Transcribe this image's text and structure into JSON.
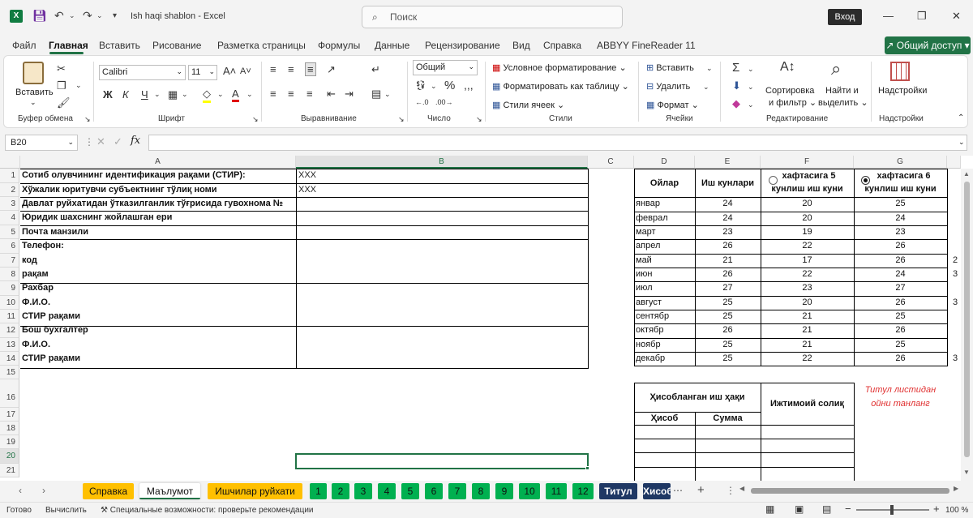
{
  "title": {
    "doc": "Ish haqi shablon",
    "sep": "-",
    "app": "Excel",
    "search": "Поиск",
    "login": "Вход"
  },
  "menu": [
    "Файл",
    "Главная",
    "Вставить",
    "Рисование",
    "Разметка страницы",
    "Формулы",
    "Данные",
    "Рецензирование",
    "Вид",
    "Справка",
    "ABBYY FineReader 11"
  ],
  "share": "Общий доступ",
  "ribbon": {
    "clipboard": {
      "paste": "Вставить",
      "label": "Буфер обмена"
    },
    "font": {
      "name": "Calibri",
      "size": "11",
      "bold": "Ж",
      "italic": "К",
      "underline": "Ч",
      "label": "Шрифт"
    },
    "align": {
      "label": "Выравнивание"
    },
    "number": {
      "format": "Общий",
      "label": "Число"
    },
    "styles": {
      "cond": "Условное форматирование",
      "table": "Форматировать как таблицу",
      "cell": "Стили ячеек",
      "label": "Стили"
    },
    "cells": {
      "insert": "Вставить",
      "delete": "Удалить",
      "format": "Формат",
      "label": "Ячейки"
    },
    "editing": {
      "sort": "Сортировка",
      "sort2": "и фильтр",
      "find": "Найти и",
      "find2": "выделить",
      "label": "Редактирование"
    },
    "addins": {
      "btn": "Надстройки",
      "label": "Надстройки"
    }
  },
  "namebox": "B20",
  "columns": [
    "A",
    "B",
    "C",
    "D",
    "E",
    "F",
    "G"
  ],
  "rows": [
    "1",
    "2",
    "3",
    "4",
    "5",
    "6",
    "7",
    "8",
    "9",
    "10",
    "11",
    "12",
    "13",
    "14",
    "15",
    "16",
    "17",
    "18",
    "19",
    "20",
    "21"
  ],
  "left": [
    {
      "a": "Сотиб олувчининг идентификация рақами (СТИР):",
      "b": "XXX"
    },
    {
      "a": "Хўжалик юритувчи субъектнинг тўлиқ номи",
      "b": "XXX"
    },
    {
      "a": "Давлат руйхатидан ўтказилганлик тўғрисида гувохнома №",
      "b": ""
    },
    {
      "a": "Юридик шахснинг жойлашган ери",
      "b": ""
    },
    {
      "a": "Почта манзили",
      "b": ""
    },
    {
      "a": "Телефон:",
      "b": ""
    },
    {
      "a": "код",
      "b": ""
    },
    {
      "a": "рақам",
      "b": ""
    },
    {
      "a": "Рахбар",
      "b": ""
    },
    {
      "a": "Ф.И.О.",
      "b": ""
    },
    {
      "a": "СТИР рақами",
      "b": ""
    },
    {
      "a": "Бош бухгалтер",
      "b": ""
    },
    {
      "a": "Ф.И.О.",
      "b": ""
    },
    {
      "a": "СТИР рақами",
      "b": ""
    }
  ],
  "months_header": {
    "month": "Ойлар",
    "days": "Иш кунлари",
    "w5a": "хафтасига 5",
    "w5b": "кунлиш иш куни",
    "w6a": "хафтасига 6",
    "w6b": "кунлиш иш куни"
  },
  "months": [
    {
      "m": "январ",
      "d": "24",
      "f": "20",
      "g": "25",
      "h": ""
    },
    {
      "m": "феврал",
      "d": "24",
      "f": "20",
      "g": "24",
      "h": ""
    },
    {
      "m": "март",
      "d": "23",
      "f": "19",
      "g": "23",
      "h": ""
    },
    {
      "m": "апрел",
      "d": "26",
      "f": "22",
      "g": "26",
      "h": ""
    },
    {
      "m": "май",
      "d": "21",
      "f": "17",
      "g": "26",
      "h": "2"
    },
    {
      "m": "июн",
      "d": "26",
      "f": "22",
      "g": "24",
      "h": "3"
    },
    {
      "m": "июл",
      "d": "27",
      "f": "23",
      "g": "27",
      "h": ""
    },
    {
      "m": "август",
      "d": "25",
      "f": "20",
      "g": "26",
      "h": "3"
    },
    {
      "m": "сентябр",
      "d": "25",
      "f": "21",
      "g": "25",
      "h": ""
    },
    {
      "m": "октябр",
      "d": "26",
      "f": "21",
      "g": "26",
      "h": ""
    },
    {
      "m": "ноябр",
      "d": "25",
      "f": "21",
      "g": "25",
      "h": ""
    },
    {
      "m": "декабр",
      "d": "25",
      "f": "22",
      "g": "26",
      "h": "3"
    }
  ],
  "salary": {
    "hdr": "Ҳисобланган иш ҳақи",
    "tax": "Ижтимоий солиқ",
    "calc": "Ҳисоб",
    "sum": "Сумма",
    "note1": "Титул листидан",
    "note2": "ойни танланг"
  },
  "sheets": [
    {
      "label": "Справка",
      "bg": "#ffc000",
      "fg": "#111"
    },
    {
      "label": "Маълумот",
      "bg": "#ffffff",
      "fg": "#111"
    },
    {
      "label": "Ишчилар руйхати",
      "bg": "#ffc000",
      "fg": "#111"
    },
    {
      "label": "1",
      "bg": "#00b050",
      "fg": "#111"
    },
    {
      "label": "2",
      "bg": "#00b050",
      "fg": "#111"
    },
    {
      "label": "3",
      "bg": "#00b050",
      "fg": "#111"
    },
    {
      "label": "4",
      "bg": "#00b050",
      "fg": "#111"
    },
    {
      "label": "5",
      "bg": "#00b050",
      "fg": "#111"
    },
    {
      "label": "6",
      "bg": "#00b050",
      "fg": "#111"
    },
    {
      "label": "7",
      "bg": "#00b050",
      "fg": "#111"
    },
    {
      "label": "8",
      "bg": "#00b050",
      "fg": "#111"
    },
    {
      "label": "9",
      "bg": "#00b050",
      "fg": "#111"
    },
    {
      "label": "10",
      "bg": "#00b050",
      "fg": "#111"
    },
    {
      "label": "11",
      "bg": "#00b050",
      "fg": "#111"
    },
    {
      "label": "12",
      "bg": "#00b050",
      "fg": "#111"
    },
    {
      "label": "Титул",
      "bg": "#1f3864",
      "fg": "#fff"
    },
    {
      "label": "Хисоб",
      "bg": "#1f3864",
      "fg": "#fff"
    }
  ],
  "status": {
    "ready": "Готово",
    "calc": "Вычислить",
    "access": "Специальные возможности: проверьте рекомендации",
    "zoom": "100 %"
  }
}
